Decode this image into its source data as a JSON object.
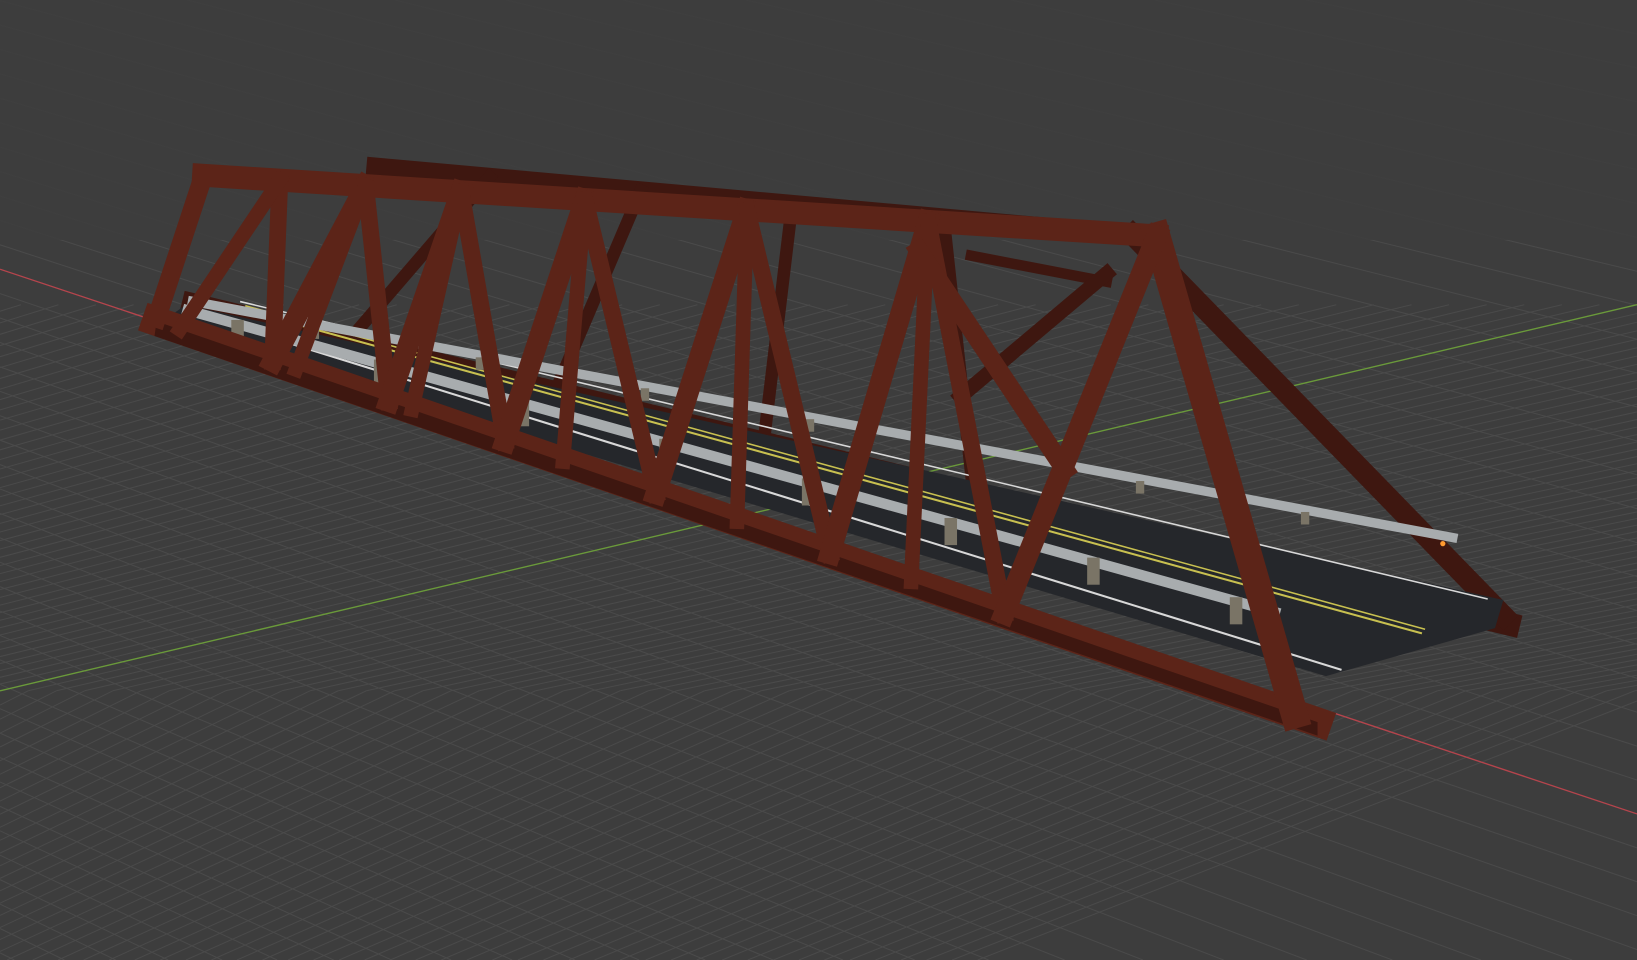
{
  "viewport": {
    "background": "#3d3d3d",
    "grid_color": "#4a4a4a",
    "x_axis_color": "#b5444c",
    "y_axis_color": "#6a9a3a"
  },
  "model": {
    "truss_color": "#5c2418",
    "truss_shadow": "#3e1710",
    "deck_color": "#25272b",
    "rail_color": "#a8acae",
    "yellow_line": "#c8c050",
    "white_line": "#d8d8d8",
    "post_color": "#7a7466"
  }
}
